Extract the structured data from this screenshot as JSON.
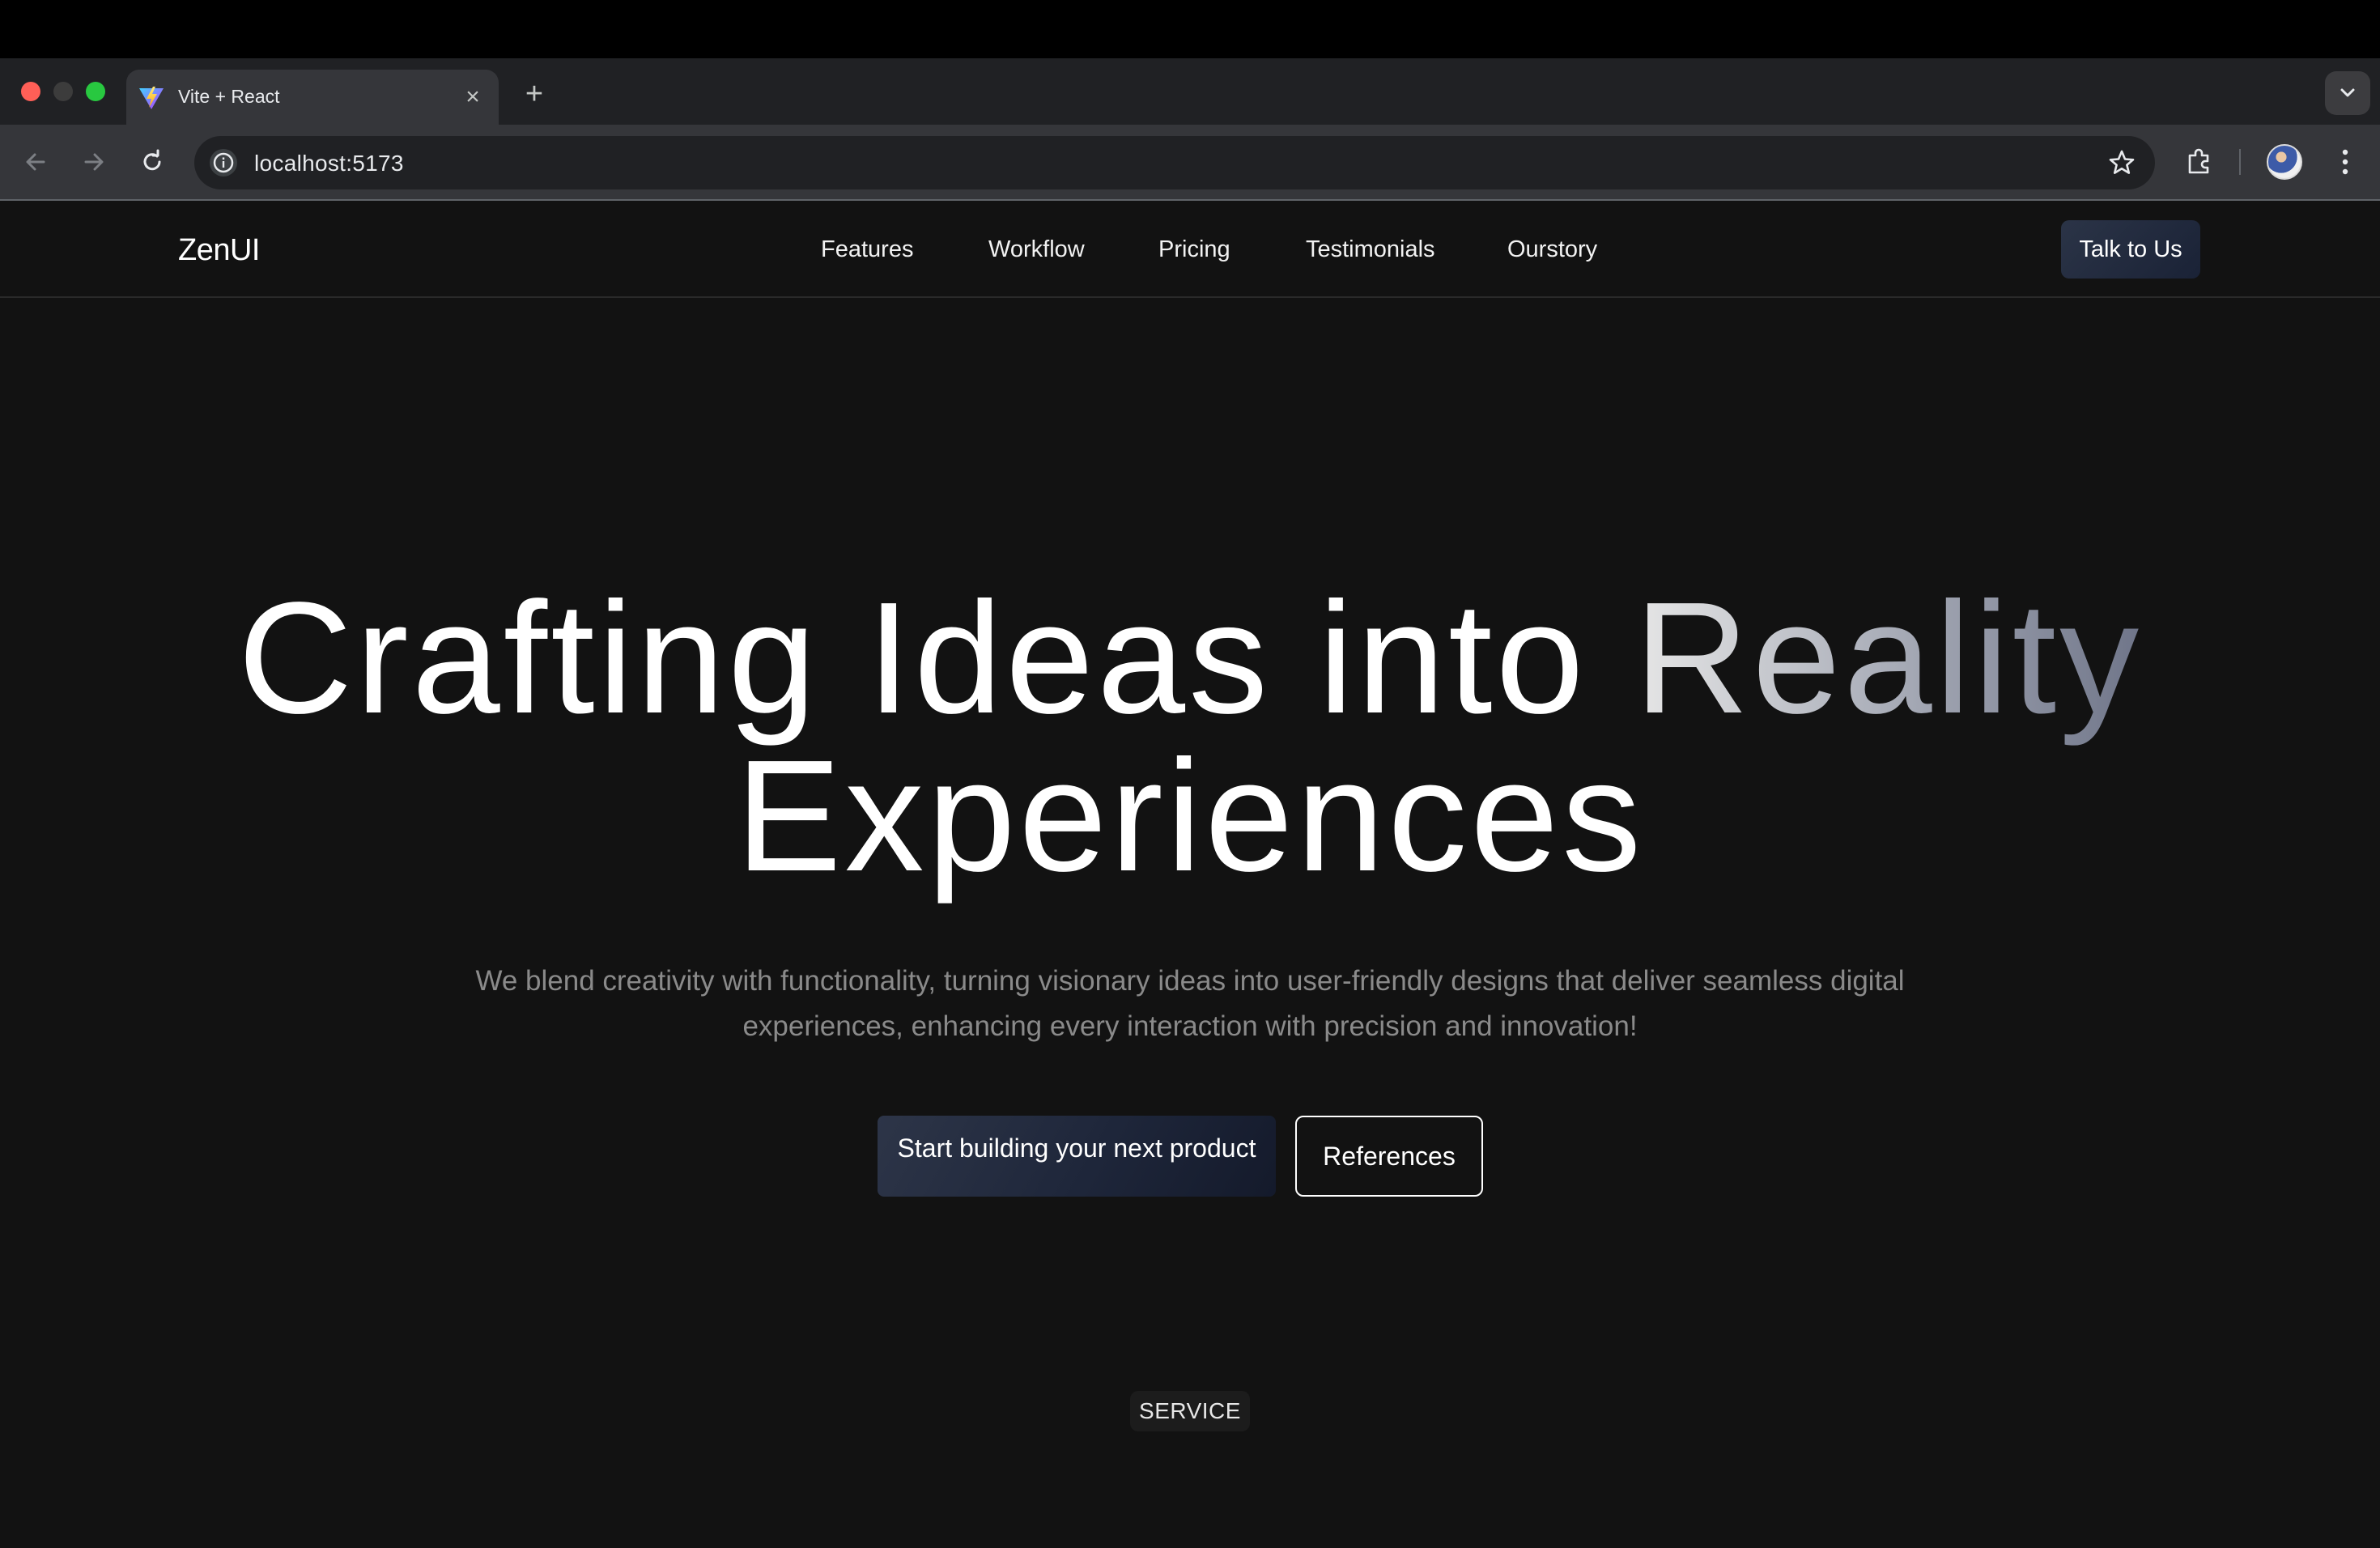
{
  "browser": {
    "tab_title": "Vite + React",
    "url": "localhost:5173",
    "icons": [
      "vite-favicon",
      "close-icon",
      "plus-icon",
      "chevron-down-icon",
      "back-arrow-icon",
      "forward-arrow-icon",
      "reload-icon",
      "info-icon",
      "star-icon",
      "extensions-icon",
      "avatar",
      "more-vert-icon"
    ]
  },
  "navbar": {
    "logo": "ZenUI",
    "links": [
      "Features",
      "Workflow",
      "Pricing",
      "Testimonials",
      "Ourstory"
    ],
    "cta": "Talk to Us"
  },
  "hero": {
    "title_line1_start": "Crafting Ideas into",
    "title_line1_highlight": "Reality",
    "title_line2": "Experiences",
    "subtitle": "We blend creativity with functionality, turning visionary ideas into user-friendly designs that deliver seamless digital experiences, enhancing every interaction with precision and innovation!",
    "primary_button": "Start building your next product",
    "secondary_button": "References"
  },
  "section": {
    "badge": "SERVICE"
  },
  "colors": {
    "page_bg": "#121212",
    "button_gradient_start": "#2d3548",
    "button_gradient_end": "#141a2b",
    "highlight_gradient_start": "#e6e6e6",
    "highlight_gradient_end": "#6f7589"
  }
}
